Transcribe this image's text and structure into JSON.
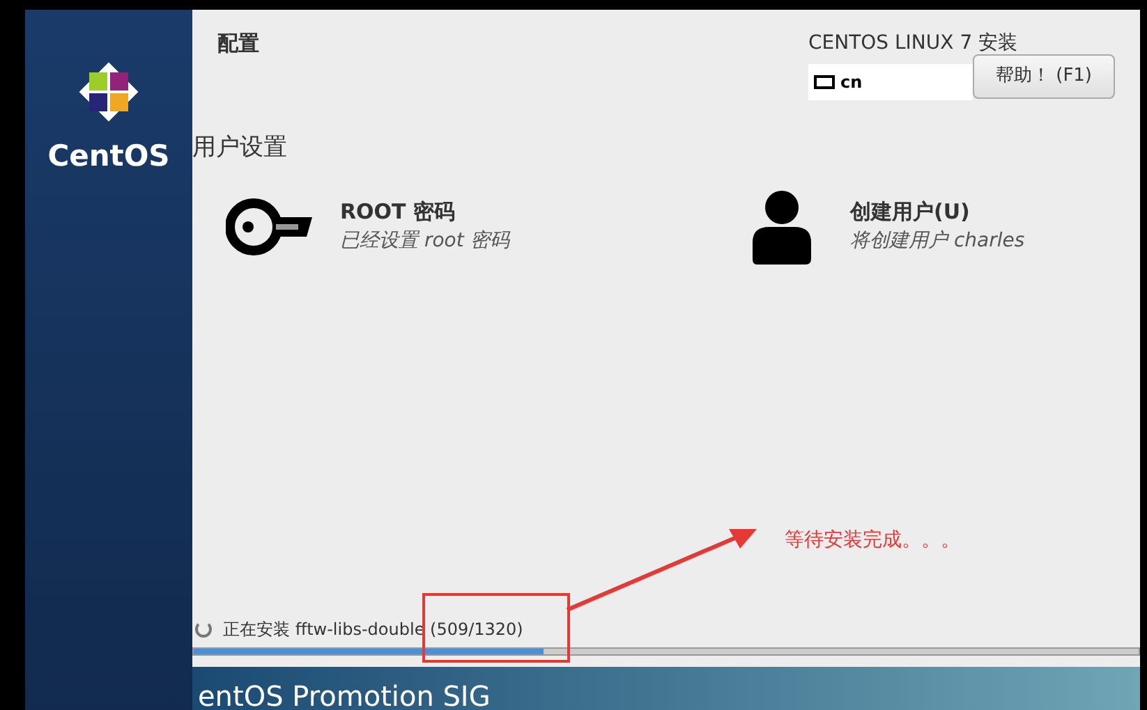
{
  "sidebar": {
    "brand": "CentOS"
  },
  "header": {
    "section_title": "配置",
    "product_title": "CENTOS LINUX 7 安装",
    "keyboard_layout": "cn",
    "help_button": "帮助！ (F1)"
  },
  "user_settings": {
    "title": "用户设置",
    "spokes": [
      {
        "kind": "key",
        "title": "ROOT 密码",
        "status": "已经设置 root 密码"
      },
      {
        "kind": "user",
        "title": "创建用户(U)",
        "status": "将创建用户 charles"
      }
    ]
  },
  "progress": {
    "status": "正在安装 fftw-libs-double (509/1320)",
    "level": 0.37
  },
  "banner": {
    "text": "entOS Promotion SIG"
  },
  "annotation": {
    "note": "等待安装完成。。。"
  }
}
